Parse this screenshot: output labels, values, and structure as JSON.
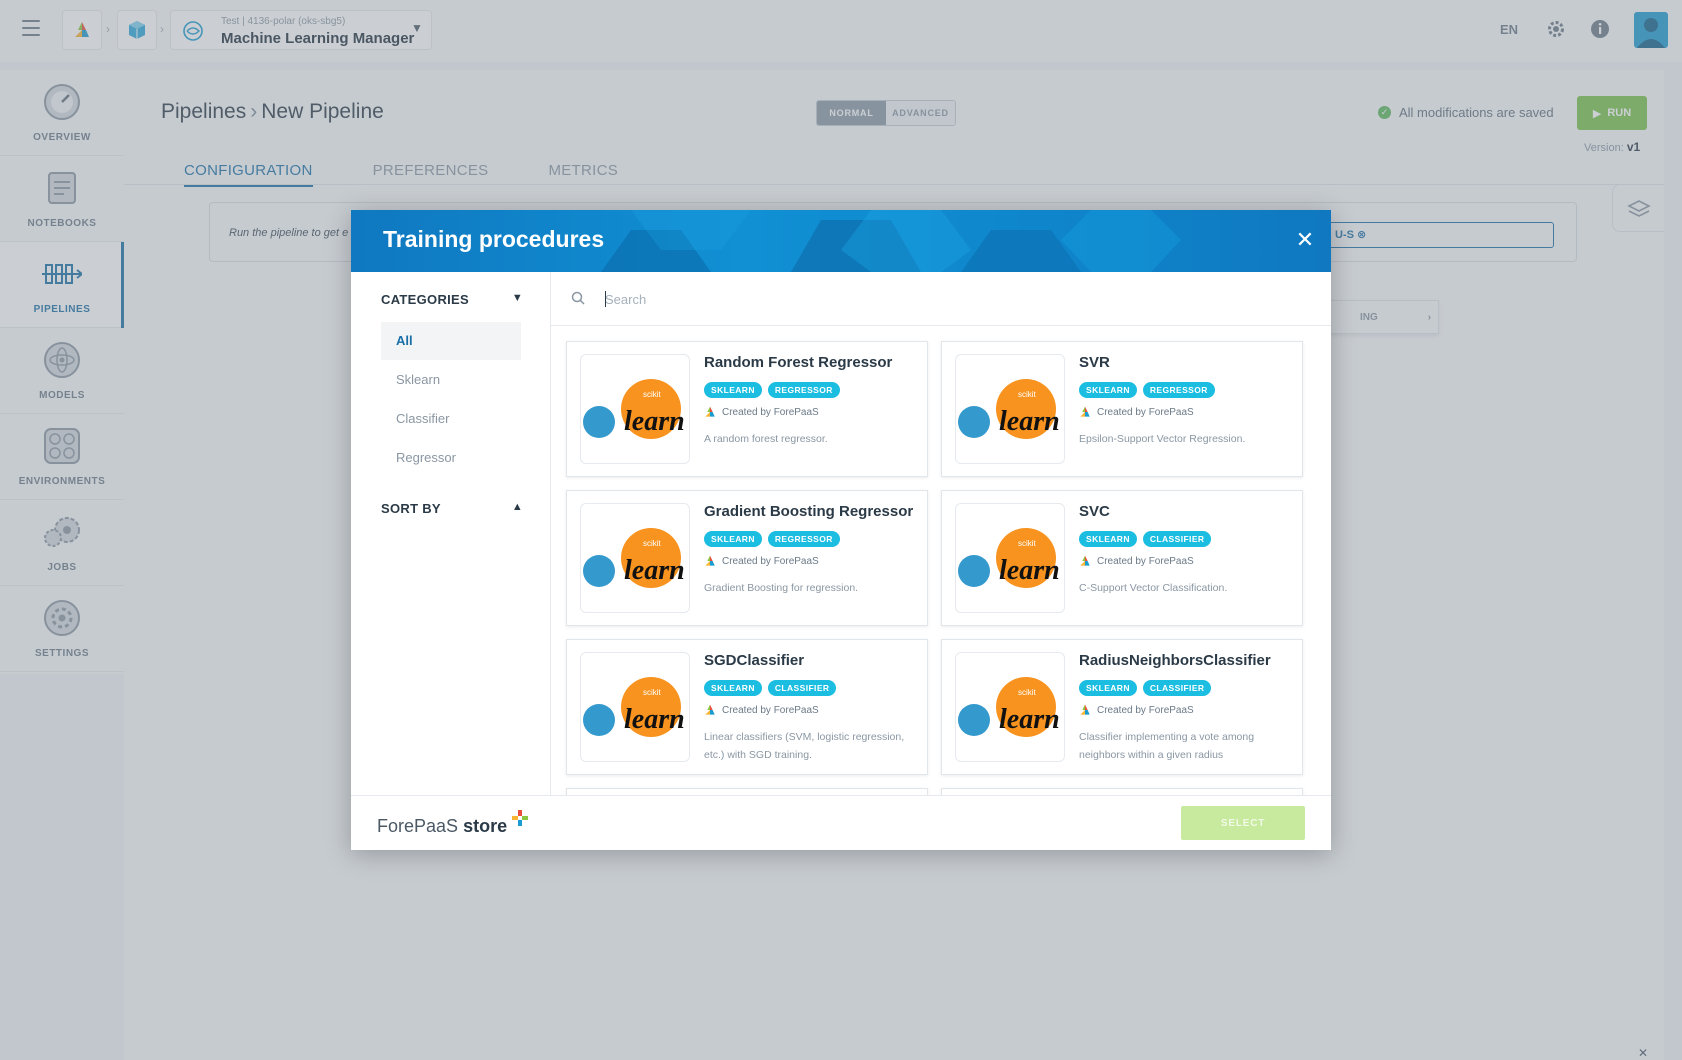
{
  "topbar": {
    "project_subtitle": "Test | 4136-polar (oks-sbg5)",
    "project_title": "Machine Learning Manager",
    "language": "EN"
  },
  "sidebar": {
    "items": [
      {
        "label": "OVERVIEW",
        "icon": "gauge-icon"
      },
      {
        "label": "NOTEBOOKS",
        "icon": "notebook-icon"
      },
      {
        "label": "PIPELINES",
        "icon": "pipeline-icon"
      },
      {
        "label": "MODELS",
        "icon": "atom-icon"
      },
      {
        "label": "ENVIRONMENTS",
        "icon": "environment-icon"
      },
      {
        "label": "JOBS",
        "icon": "gears-icon"
      },
      {
        "label": "SETTINGS",
        "icon": "settings-icon"
      }
    ],
    "active": "PIPELINES"
  },
  "page": {
    "breadcrumb_root": "Pipelines",
    "breadcrumb_current": "New Pipeline",
    "mode_normal": "NORMAL",
    "mode_advanced": "ADVANCED",
    "saved_text": "All modifications are saved",
    "run_label": "RUN",
    "version_label": "Version:",
    "version_value": "v1",
    "tabs": [
      "CONFIGURATION",
      "PREFERENCES",
      "METRICS"
    ],
    "hint_text": "Run the pipeline to get e",
    "field_text": "U-S",
    "button_fragment": "ING"
  },
  "modal": {
    "title": "Training procedures",
    "categories_label": "CATEGORIES",
    "categories": [
      "All",
      "Sklearn",
      "Classifier",
      "Regressor"
    ],
    "sort_label": "SORT BY",
    "search_placeholder": "Search",
    "cards": [
      {
        "title": "Random Forest Regressor",
        "badges": [
          "SKLEARN",
          "REGRESSOR"
        ],
        "creator": "Created by ForePaaS",
        "description": "A random forest regressor."
      },
      {
        "title": "SVR",
        "badges": [
          "SKLEARN",
          "REGRESSOR"
        ],
        "creator": "Created by ForePaaS",
        "description": "Epsilon-Support Vector Regression."
      },
      {
        "title": "Gradient Boosting Regressor",
        "badges": [
          "SKLEARN",
          "REGRESSOR"
        ],
        "creator": "Created by ForePaaS",
        "description": "Gradient Boosting for regression."
      },
      {
        "title": "SVC",
        "badges": [
          "SKLEARN",
          "CLASSIFIER"
        ],
        "creator": "Created by ForePaaS",
        "description": "C-Support Vector Classification."
      },
      {
        "title": "SGDClassifier",
        "badges": [
          "SKLEARN",
          "CLASSIFIER"
        ],
        "creator": "Created by ForePaaS",
        "description": "Linear classifiers (SVM, logistic regression, etc.) with SGD training."
      },
      {
        "title": "RadiusNeighborsClassifier",
        "badges": [
          "SKLEARN",
          "CLASSIFIER"
        ],
        "creator": "Created by ForePaaS",
        "description": "Classifier implementing a vote among neighbors within a given radius"
      }
    ],
    "logo_text": "learn",
    "logo_small": "scikit",
    "store_brand": "ForePaaS",
    "store_word": "store",
    "select_label": "SELECT"
  },
  "colors": {
    "accent": "#1a6fa8",
    "run_green": "#79c24a",
    "badge_cyan": "#1bbde0",
    "sklearn_orange": "#f7931e",
    "sklearn_blue": "#3499cd"
  }
}
